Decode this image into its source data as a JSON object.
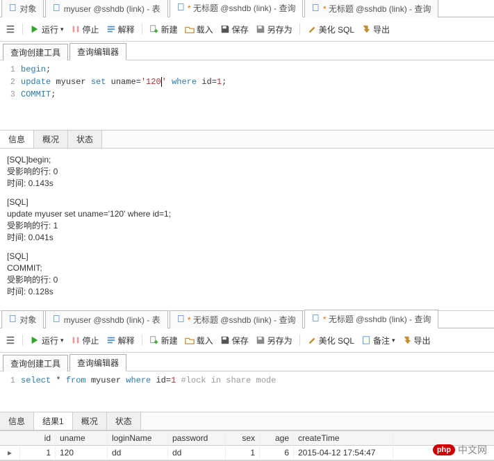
{
  "top": {
    "doc_tabs": [
      {
        "label": "对象"
      },
      {
        "label": "myuser @sshdb (link) - 表"
      },
      {
        "label": "* 无标题 @sshdb (link) - 查询",
        "dirty": true,
        "active": true
      },
      {
        "label": "* 无标题 @sshdb (link) - 查询",
        "dirty": true
      }
    ],
    "toolbar": {
      "run": "运行",
      "stop": "停止",
      "explain": "解释",
      "create": "新建",
      "load": "载入",
      "save": "保存",
      "saveas": "另存为",
      "beautify": "美化 SQL",
      "export": "导出"
    },
    "subtabs": [
      {
        "label": "查询创建工具"
      },
      {
        "label": "查询编辑器",
        "active": true
      }
    ],
    "code": [
      [
        {
          "t": "begin",
          "c": "kw"
        },
        {
          "t": ";"
        }
      ],
      [
        {
          "t": "update",
          "c": "kw"
        },
        {
          "t": " myuser "
        },
        {
          "t": "set",
          "c": "kw"
        },
        {
          "t": " uname="
        },
        {
          "t": "'120'",
          "c": "str",
          "cur": 3
        },
        {
          "t": " "
        },
        {
          "t": "where",
          "c": "kw"
        },
        {
          "t": " id="
        },
        {
          "t": "1",
          "c": "num"
        },
        {
          "t": ";"
        }
      ],
      [
        {
          "t": "COMMIT",
          "c": "kw"
        },
        {
          "t": ";"
        }
      ]
    ],
    "out_tabs": [
      {
        "label": "信息",
        "active": true
      },
      {
        "label": "概况"
      },
      {
        "label": "状态"
      }
    ],
    "output": [
      [
        "[SQL]begin;",
        "受影响的行: 0",
        "时间: 0.143s"
      ],
      [
        "[SQL]",
        "update myuser set uname='120' where id=1;",
        "受影响的行: 1",
        "时间: 0.041s"
      ],
      [
        "[SQL]",
        "COMMIT;",
        "受影响的行: 0",
        "时间: 0.128s"
      ]
    ]
  },
  "bottom": {
    "doc_tabs": [
      {
        "label": "对象"
      },
      {
        "label": "myuser @sshdb (link) - 表"
      },
      {
        "label": "* 无标题 @sshdb (link) - 查询",
        "dirty": true
      },
      {
        "label": "* 无标题 @sshdb (link) - 查询",
        "dirty": true,
        "active": true
      }
    ],
    "toolbar": {
      "run": "运行",
      "stop": "停止",
      "explain": "解释",
      "create": "新建",
      "load": "载入",
      "save": "保存",
      "saveas": "另存为",
      "beautify": "美化 SQL",
      "notes": "备注",
      "export": "导出"
    },
    "subtabs": [
      {
        "label": "查询创建工具"
      },
      {
        "label": "查询编辑器",
        "active": true
      }
    ],
    "code": [
      [
        {
          "t": "select",
          "c": "kw"
        },
        {
          "t": " * "
        },
        {
          "t": "from",
          "c": "kw"
        },
        {
          "t": " myuser "
        },
        {
          "t": "where",
          "c": "kw"
        },
        {
          "t": " id="
        },
        {
          "t": "1",
          "c": "num"
        },
        {
          "t": " "
        },
        {
          "t": "#lock in share mode",
          "c": "cmt"
        }
      ]
    ],
    "out_tabs": [
      {
        "label": "信息"
      },
      {
        "label": "结果1",
        "active": true
      },
      {
        "label": "概况"
      },
      {
        "label": "状态"
      }
    ],
    "grid": {
      "columns": [
        "id",
        "uname",
        "loginName",
        "password",
        "sex",
        "age",
        "createTime"
      ],
      "row": {
        "id": "1",
        "uname": "120",
        "loginName": "dd",
        "password": "dd",
        "sex": "1",
        "age": "6",
        "createTime": "2015-04-12 17:54:47"
      }
    }
  },
  "watermark": {
    "bubble": "php",
    "text": "中文网"
  }
}
